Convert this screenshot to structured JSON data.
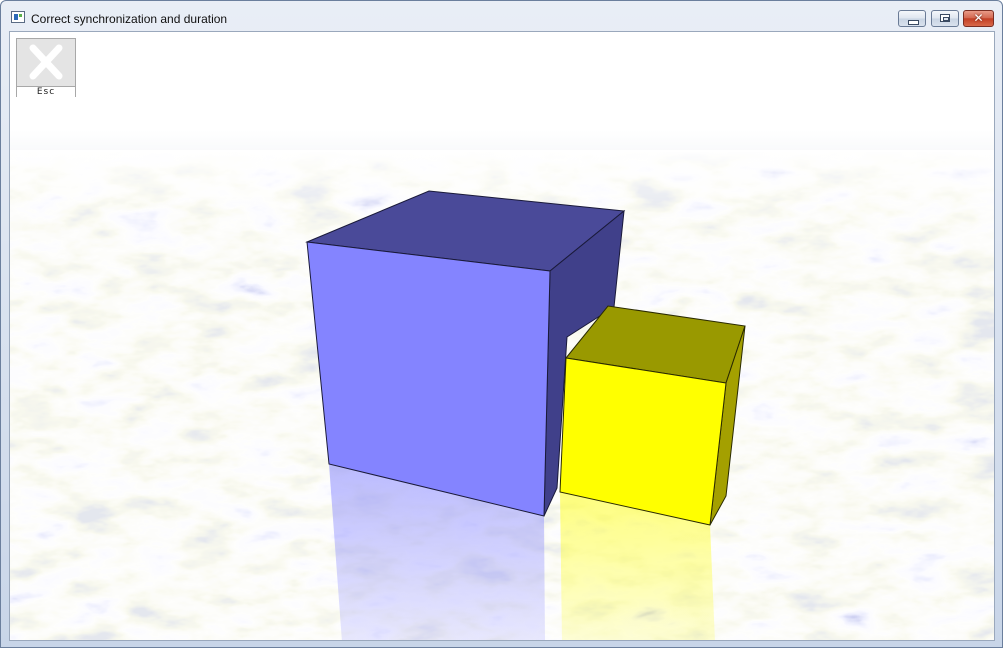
{
  "window": {
    "title": "Correct synchronization and duration",
    "controls": {
      "minimize": "",
      "maximize": "",
      "close": "✕"
    }
  },
  "toolbar": {
    "esc_label": "Esc",
    "esc_icon": "close-x-icon"
  },
  "scene": {
    "floor_texture": "white marble",
    "objects": [
      {
        "name": "blue-cube",
        "front_color": "#8484ff",
        "top_color": "#4a4a99",
        "side_color": "#40408a"
      },
      {
        "name": "yellow-cube",
        "front_color": "#ffff00",
        "top_color": "#999900",
        "side_color": "#a4a000"
      }
    ]
  }
}
